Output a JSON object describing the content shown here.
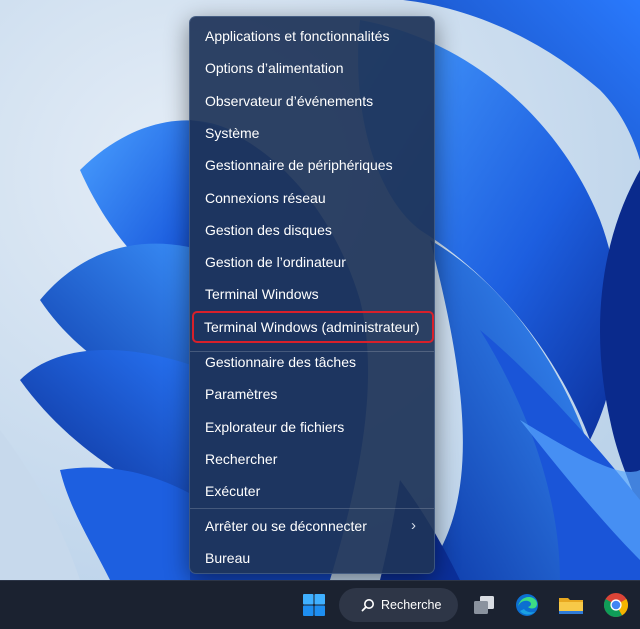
{
  "context_menu": {
    "items": [
      {
        "label": "Applications et fonctionnalités"
      },
      {
        "label": "Options d’alimentation"
      },
      {
        "label": "Observateur d’événements"
      },
      {
        "label": "Système"
      },
      {
        "label": "Gestionnaire de périphériques"
      },
      {
        "label": "Connexions réseau"
      },
      {
        "label": "Gestion des disques"
      },
      {
        "label": "Gestion de l’ordinateur"
      },
      {
        "label": "Terminal Windows"
      },
      {
        "label": "Terminal Windows (administrateur)",
        "highlighted": true
      },
      {
        "label": "Gestionnaire des tâches"
      },
      {
        "label": "Paramètres"
      },
      {
        "label": "Explorateur de fichiers"
      },
      {
        "label": "Rechercher"
      },
      {
        "label": "Exécuter"
      },
      {
        "label": "Arrêter ou se déconnecter",
        "has_submenu": true
      },
      {
        "label": "Bureau"
      }
    ],
    "highlight_color": "#d8202a"
  },
  "taskbar": {
    "search_label": "Recherche",
    "icons": [
      "windows-start-icon",
      "search-icon",
      "task-view-icon",
      "edge-icon",
      "file-explorer-icon",
      "chrome-icon"
    ]
  },
  "colors": {
    "menu_background": "#1e3458",
    "taskbar_background": "#1b2230",
    "wallpaper_blue": "#1d5fe0"
  }
}
